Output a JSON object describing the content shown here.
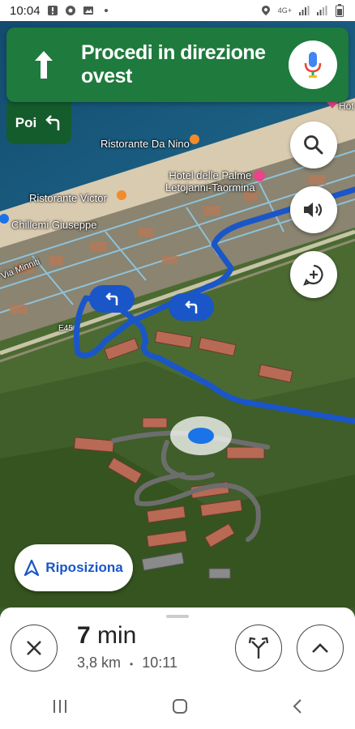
{
  "status_bar": {
    "time": "10:04",
    "network": "4G+"
  },
  "banner": {
    "instruction": "Procedi in direzione ovest",
    "then_label": "Poi"
  },
  "map_labels": {
    "restaurant_1": "Ristorante Da Nino",
    "hotel_line1": "Hotel delle Palme",
    "hotel_line2": "Letojanni-Taormina",
    "restaurant_2": "Ristorante Victor",
    "business": "Chillemi Giuseppe",
    "street": "Via Minniti",
    "highway": "E45",
    "edge_label": "Hot"
  },
  "recenter_label": "Riposiziona",
  "trip": {
    "duration_value": "7",
    "duration_unit": "min",
    "distance": "3,8 km",
    "separator": "•",
    "arrival": "10:11"
  },
  "colors": {
    "banner": "#1e7a3d",
    "banner_dark": "#155c2d",
    "route": "#1a56c8"
  },
  "icons": {
    "banner": "arrow-up-icon",
    "then": "turn-left-icon",
    "search": "search-icon",
    "sound": "volume-icon",
    "report": "add-report-icon",
    "recenter": "navigation-arrow-icon",
    "close": "close-icon",
    "routes": "alternate-routes-icon",
    "expand": "chevron-up-icon"
  }
}
